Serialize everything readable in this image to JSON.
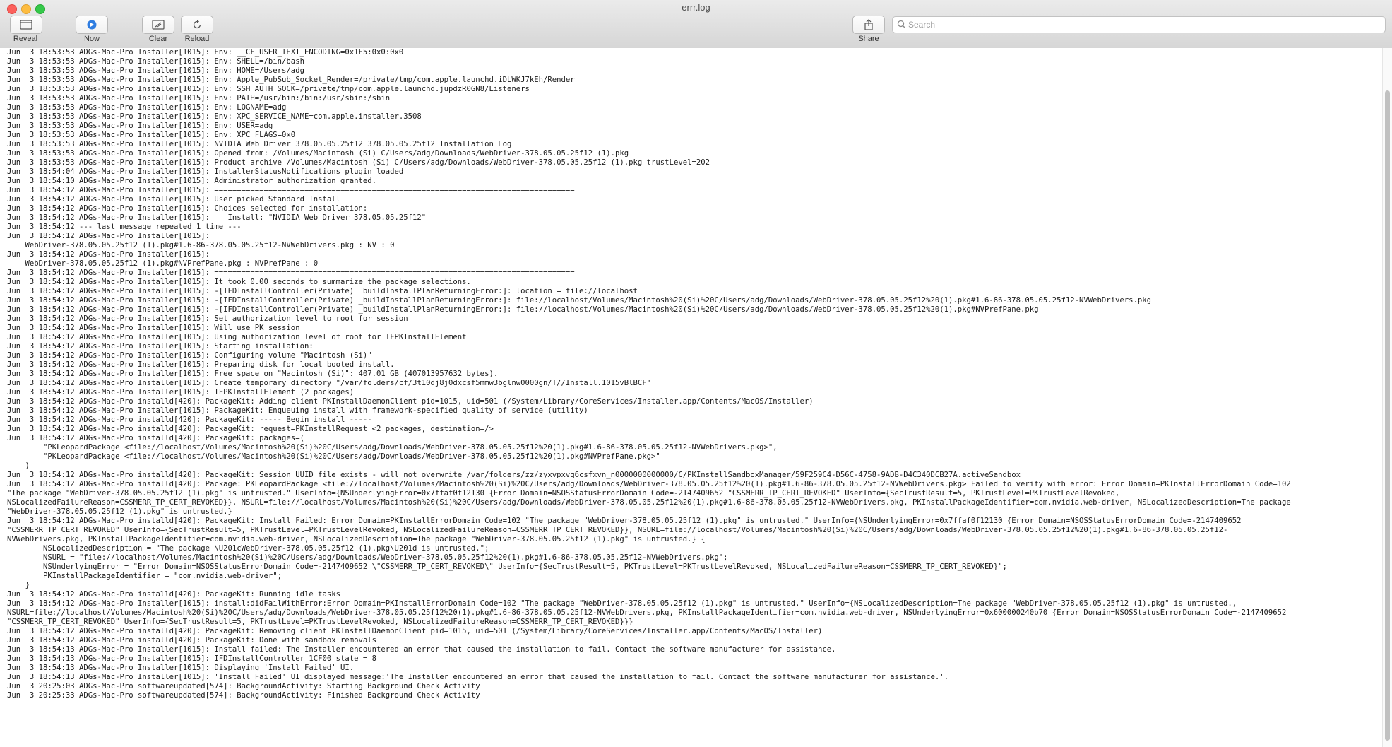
{
  "window": {
    "title": "errr.log"
  },
  "toolbar": {
    "reveal_label": "Reveal",
    "now_label": "Now",
    "clear_label": "Clear",
    "reload_label": "Reload",
    "share_label": "Share"
  },
  "search": {
    "placeholder": "Search"
  },
  "log": {
    "text": "Jun  3 18:53:53 ADGs-Mac-Pro Installer[1015]: Env: __CF_USER_TEXT_ENCODING=0x1F5:0x0:0x0\nJun  3 18:53:53 ADGs-Mac-Pro Installer[1015]: Env: SHELL=/bin/bash\nJun  3 18:53:53 ADGs-Mac-Pro Installer[1015]: Env: HOME=/Users/adg\nJun  3 18:53:53 ADGs-Mac-Pro Installer[1015]: Env: Apple_PubSub_Socket_Render=/private/tmp/com.apple.launchd.iDLWKJ7kEh/Render\nJun  3 18:53:53 ADGs-Mac-Pro Installer[1015]: Env: SSH_AUTH_SOCK=/private/tmp/com.apple.launchd.jupdzR0GN8/Listeners\nJun  3 18:53:53 ADGs-Mac-Pro Installer[1015]: Env: PATH=/usr/bin:/bin:/usr/sbin:/sbin\nJun  3 18:53:53 ADGs-Mac-Pro Installer[1015]: Env: LOGNAME=adg\nJun  3 18:53:53 ADGs-Mac-Pro Installer[1015]: Env: XPC_SERVICE_NAME=com.apple.installer.3508\nJun  3 18:53:53 ADGs-Mac-Pro Installer[1015]: Env: USER=adg\nJun  3 18:53:53 ADGs-Mac-Pro Installer[1015]: Env: XPC_FLAGS=0x0\nJun  3 18:53:53 ADGs-Mac-Pro Installer[1015]: NVIDIA Web Driver 378.05.05.25f12 378.05.05.25f12 Installation Log\nJun  3 18:53:53 ADGs-Mac-Pro Installer[1015]: Opened from: /Volumes/Macintosh (Si) C/Users/adg/Downloads/WebDriver-378.05.05.25f12 (1).pkg\nJun  3 18:53:53 ADGs-Mac-Pro Installer[1015]: Product archive /Volumes/Macintosh (Si) C/Users/adg/Downloads/WebDriver-378.05.05.25f12 (1).pkg trustLevel=202\nJun  3 18:54:04 ADGs-Mac-Pro Installer[1015]: InstallerStatusNotifications plugin loaded\nJun  3 18:54:10 ADGs-Mac-Pro Installer[1015]: Administrator authorization granted.\nJun  3 18:54:12 ADGs-Mac-Pro Installer[1015]: ================================================================================\nJun  3 18:54:12 ADGs-Mac-Pro Installer[1015]: User picked Standard Install\nJun  3 18:54:12 ADGs-Mac-Pro Installer[1015]: Choices selected for installation:\nJun  3 18:54:12 ADGs-Mac-Pro Installer[1015]:    Install: \"NVIDIA Web Driver 378.05.05.25f12\"\nJun  3 18:54:12 --- last message repeated 1 time ---\nJun  3 18:54:12 ADGs-Mac-Pro Installer[1015]:\n    WebDriver-378.05.05.25f12 (1).pkg#1.6-86-378.05.05.25f12-NVWebDrivers.pkg : NV : 0\nJun  3 18:54:12 ADGs-Mac-Pro Installer[1015]:\n    WebDriver-378.05.05.25f12 (1).pkg#NVPrefPane.pkg : NVPrefPane : 0\nJun  3 18:54:12 ADGs-Mac-Pro Installer[1015]: ================================================================================\nJun  3 18:54:12 ADGs-Mac-Pro Installer[1015]: It took 0.00 seconds to summarize the package selections.\nJun  3 18:54:12 ADGs-Mac-Pro Installer[1015]: -[IFDInstallController(Private) _buildInstallPlanReturningError:]: location = file://localhost\nJun  3 18:54:12 ADGs-Mac-Pro Installer[1015]: -[IFDInstallController(Private) _buildInstallPlanReturningError:]: file://localhost/Volumes/Macintosh%20(Si)%20C/Users/adg/Downloads/WebDriver-378.05.05.25f12%20(1).pkg#1.6-86-378.05.05.25f12-NVWebDrivers.pkg\nJun  3 18:54:12 ADGs-Mac-Pro Installer[1015]: -[IFDInstallController(Private) _buildInstallPlanReturningError:]: file://localhost/Volumes/Macintosh%20(Si)%20C/Users/adg/Downloads/WebDriver-378.05.05.25f12%20(1).pkg#NVPrefPane.pkg\nJun  3 18:54:12 ADGs-Mac-Pro Installer[1015]: Set authorization level to root for session\nJun  3 18:54:12 ADGs-Mac-Pro Installer[1015]: Will use PK session\nJun  3 18:54:12 ADGs-Mac-Pro Installer[1015]: Using authorization level of root for IFPKInstallElement\nJun  3 18:54:12 ADGs-Mac-Pro Installer[1015]: Starting installation:\nJun  3 18:54:12 ADGs-Mac-Pro Installer[1015]: Configuring volume \"Macintosh (Si)\"\nJun  3 18:54:12 ADGs-Mac-Pro Installer[1015]: Preparing disk for local booted install.\nJun  3 18:54:12 ADGs-Mac-Pro Installer[1015]: Free space on \"Macintosh (Si)\": 407.01 GB (407013957632 bytes).\nJun  3 18:54:12 ADGs-Mac-Pro Installer[1015]: Create temporary directory \"/var/folders/cf/3t10dj8j0dxcsf5mmw3bglnw0000gn/T//Install.1015vBlBCF\"\nJun  3 18:54:12 ADGs-Mac-Pro Installer[1015]: IFPKInstallElement (2 packages)\nJun  3 18:54:12 ADGs-Mac-Pro installd[420]: PackageKit: Adding client PKInstallDaemonClient pid=1015, uid=501 (/System/Library/CoreServices/Installer.app/Contents/MacOS/Installer)\nJun  3 18:54:12 ADGs-Mac-Pro Installer[1015]: PackageKit: Enqueuing install with framework-specified quality of service (utility)\nJun  3 18:54:12 ADGs-Mac-Pro installd[420]: PackageKit: ----- Begin install -----\nJun  3 18:54:12 ADGs-Mac-Pro installd[420]: PackageKit: request=PKInstallRequest <2 packages, destination=/>\nJun  3 18:54:12 ADGs-Mac-Pro installd[420]: PackageKit: packages=(\n        \"PKLeopardPackage <file://localhost/Volumes/Macintosh%20(Si)%20C/Users/adg/Downloads/WebDriver-378.05.05.25f12%20(1).pkg#1.6-86-378.05.05.25f12-NVWebDrivers.pkg>\",\n        \"PKLeopardPackage <file://localhost/Volumes/Macintosh%20(Si)%20C/Users/adg/Downloads/WebDriver-378.05.05.25f12%20(1).pkg#NVPrefPane.pkg>\"\n    )\nJun  3 18:54:12 ADGs-Mac-Pro installd[420]: PackageKit: Session UUID file exists - will not overwrite /var/folders/zz/zyxvpxvq6csfxvn_n0000000000000/C/PKInstallSandboxManager/59F259C4-D56C-4758-9ADB-D4C340DCB27A.activeSandbox\nJun  3 18:54:12 ADGs-Mac-Pro installd[420]: Package: PKLeopardPackage <file://localhost/Volumes/Macintosh%20(Si)%20C/Users/adg/Downloads/WebDriver-378.05.05.25f12%20(1).pkg#1.6-86-378.05.05.25f12-NVWebDrivers.pkg> Failed to verify with error: Error Domain=PKInstallErrorDomain Code=102\n\"The package \"WebDriver-378.05.05.25f12 (1).pkg\" is untrusted.\" UserInfo={NSUnderlyingError=0x7ffaf0f12130 {Error Domain=NSOSStatusErrorDomain Code=-2147409652 \"CSSMERR_TP_CERT_REVOKED\" UserInfo={SecTrustResult=5, PKTrustLevel=PKTrustLevelRevoked,\nNSLocalizedFailureReason=CSSMERR_TP_CERT_REVOKED}}, NSURL=file://localhost/Volumes/Macintosh%20(Si)%20C/Users/adg/Downloads/WebDriver-378.05.05.25f12%20(1).pkg#1.6-86-378.05.05.25f12-NVWebDrivers.pkg, PKInstallPackageIdentifier=com.nvidia.web-driver, NSLocalizedDescription=The package\n\"WebDriver-378.05.05.25f12 (1).pkg\" is untrusted.}\nJun  3 18:54:12 ADGs-Mac-Pro installd[420]: PackageKit: Install Failed: Error Domain=PKInstallErrorDomain Code=102 \"The package \"WebDriver-378.05.05.25f12 (1).pkg\" is untrusted.\" UserInfo={NSUnderlyingError=0x7ffaf0f12130 {Error Domain=NSOSStatusErrorDomain Code=-2147409652\n\"CSSMERR_TP_CERT_REVOKED\" UserInfo={SecTrustResult=5, PKTrustLevel=PKTrustLevelRevoked, NSLocalizedFailureReason=CSSMERR_TP_CERT_REVOKED}}, NSURL=file://localhost/Volumes/Macintosh%20(Si)%20C/Users/adg/Downloads/WebDriver-378.05.05.25f12%20(1).pkg#1.6-86-378.05.05.25f12-\nNVWebDrivers.pkg, PKInstallPackageIdentifier=com.nvidia.web-driver, NSLocalizedDescription=The package \"WebDriver-378.05.05.25f12 (1).pkg\" is untrusted.} {\n        NSLocalizedDescription = \"The package \\U201cWebDriver-378.05.05.25f12 (1).pkg\\U201d is untrusted.\";\n        NSURL = \"file://localhost/Volumes/Macintosh%20(Si)%20C/Users/adg/Downloads/WebDriver-378.05.05.25f12%20(1).pkg#1.6-86-378.05.05.25f12-NVWebDrivers.pkg\";\n        NSUnderlyingError = \"Error Domain=NSOSStatusErrorDomain Code=-2147409652 \\\"CSSMERR_TP_CERT_REVOKED\\\" UserInfo={SecTrustResult=5, PKTrustLevel=PKTrustLevelRevoked, NSLocalizedFailureReason=CSSMERR_TP_CERT_REVOKED}\";\n        PKInstallPackageIdentifier = \"com.nvidia.web-driver\";\n    }\nJun  3 18:54:12 ADGs-Mac-Pro installd[420]: PackageKit: Running idle tasks\nJun  3 18:54:12 ADGs-Mac-Pro Installer[1015]: install:didFailWithError:Error Domain=PKInstallErrorDomain Code=102 \"The package \"WebDriver-378.05.05.25f12 (1).pkg\" is untrusted.\" UserInfo={NSLocalizedDescription=The package \"WebDriver-378.05.05.25f12 (1).pkg\" is untrusted.,\nNSURL=file://localhost/Volumes/Macintosh%20(Si)%20C/Users/adg/Downloads/WebDriver-378.05.05.25f12%20(1).pkg#1.6-86-378.05.05.25f12-NVWebDrivers.pkg, PKInstallPackageIdentifier=com.nvidia.web-driver, NSUnderlyingError=0x600000240b70 {Error Domain=NSOSStatusErrorDomain Code=-2147409652\n\"CSSMERR_TP_CERT_REVOKED\" UserInfo={SecTrustResult=5, PKTrustLevel=PKTrustLevelRevoked, NSLocalizedFailureReason=CSSMERR_TP_CERT_REVOKED}}}\nJun  3 18:54:12 ADGs-Mac-Pro installd[420]: PackageKit: Removing client PKInstallDaemonClient pid=1015, uid=501 (/System/Library/CoreServices/Installer.app/Contents/MacOS/Installer)\nJun  3 18:54:12 ADGs-Mac-Pro installd[420]: PackageKit: Done with sandbox removals\nJun  3 18:54:13 ADGs-Mac-Pro Installer[1015]: Install failed: The Installer encountered an error that caused the installation to fail. Contact the software manufacturer for assistance.\nJun  3 18:54:13 ADGs-Mac-Pro Installer[1015]: IFDInstallController 1CF00 state = 8\nJun  3 18:54:13 ADGs-Mac-Pro Installer[1015]: Displaying 'Install Failed' UI.\nJun  3 18:54:13 ADGs-Mac-Pro Installer[1015]: 'Install Failed' UI displayed message:'The Installer encountered an error that caused the installation to fail. Contact the software manufacturer for assistance.'.\nJun  3 20:25:03 ADGs-Mac-Pro softwareupdated[574]: BackgroundActivity: Starting Background Check Activity\nJun  3 20:25:33 ADGs-Mac-Pro softwareupdated[574]: BackgroundActivity: Finished Background Check Activity"
  }
}
